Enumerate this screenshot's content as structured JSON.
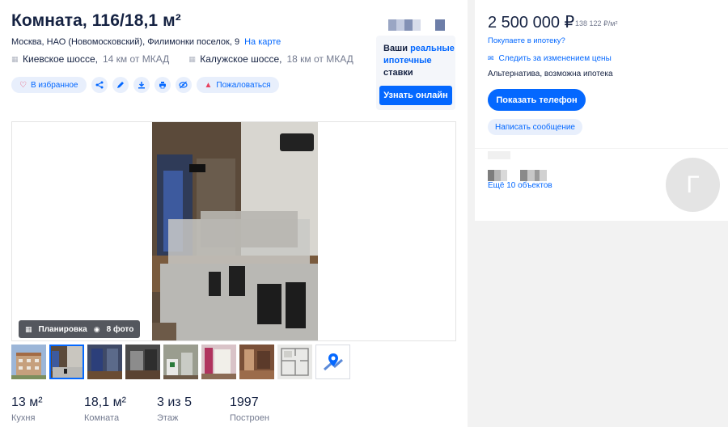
{
  "listing": {
    "title": "Комната, 116/18,1 м²",
    "address": "Москва, НАО (Новомосковский), Филимонки поселок, 9",
    "map_link": "На карте",
    "roads": [
      {
        "name": "Киевское шоссе,",
        "distance": "14 км от МКАД"
      },
      {
        "name": "Калужское шоссе,",
        "distance": "18 км от МКАД"
      }
    ]
  },
  "actions": {
    "favorite": "В избранное",
    "report": "Пожаловаться",
    "icons": [
      "share-icon",
      "edit-icon",
      "download-icon",
      "print-icon",
      "hide-icon"
    ]
  },
  "mortgage_card": {
    "text_1": "Ваши ",
    "text_highlight": "реальные ипотечные",
    "text_2": " ставки",
    "button": "Узнать онлайн"
  },
  "gallery": {
    "plan_label": "Планировка",
    "photos_label": "8 фото",
    "thumb_count": 8
  },
  "facts": [
    {
      "value": "13 м²",
      "label": "Кухня"
    },
    {
      "value": "18,1 м²",
      "label": "Комната"
    },
    {
      "value": "3 из 5",
      "label": "Этаж"
    },
    {
      "value": "1997",
      "label": "Построен"
    }
  ],
  "price_card": {
    "price": "2 500 000 ₽",
    "price_per_m2": "138 122 ₽/м²",
    "mortgage_link": "Покупаете в ипотеку?",
    "follow_price": "Следить за изменением цены",
    "deal_type": "Альтернатива, возможна ипотека",
    "show_phone": "Показать телефон",
    "write_message": "Написать сообщение"
  },
  "agent": {
    "objects_link": "Ещё 10 объектов",
    "avatar_letter": "Г"
  },
  "colors": {
    "accent": "#0468ff",
    "text": "#152242",
    "muted": "#737a8f",
    "chip_bg": "#e8effc",
    "page_bg": "#f2f2f2"
  }
}
